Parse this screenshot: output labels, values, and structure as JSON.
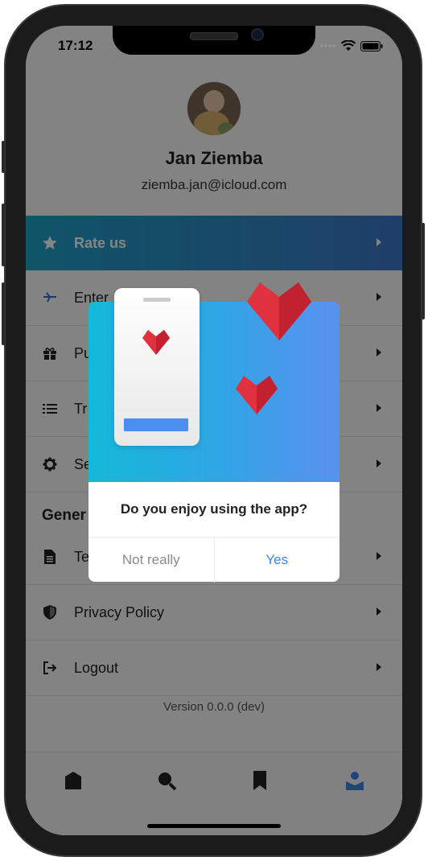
{
  "status": {
    "time": "17:12"
  },
  "profile": {
    "name": "Jan Ziemba",
    "email": "ziemba.jan@icloud.com"
  },
  "menu": {
    "items": [
      {
        "label": "Rate us",
        "icon": "star-icon"
      },
      {
        "label": "Enter",
        "icon": "plane-icon"
      },
      {
        "label": "Pu",
        "icon": "gift-icon"
      },
      {
        "label": "Tr",
        "icon": "list-icon"
      },
      {
        "label": "Se",
        "icon": "gear-icon"
      }
    ],
    "section_general": "Gener",
    "general_items": [
      {
        "label": "Te",
        "icon": "document-icon"
      },
      {
        "label": "Privacy Policy",
        "icon": "shield-icon"
      },
      {
        "label": "Logout",
        "icon": "logout-icon"
      }
    ]
  },
  "version": "Version 0.0.0 (dev)",
  "tabbar": {
    "tabs": [
      "home-icon",
      "search-icon",
      "bookmark-icon",
      "profile-icon"
    ],
    "active_color": "#3b86f0"
  },
  "dialog": {
    "question": "Do you enjoy using the app?",
    "no_label": "Not really",
    "yes_label": "Yes"
  },
  "colors": {
    "accent": "#3c78c9",
    "heart": "#e0313f"
  }
}
